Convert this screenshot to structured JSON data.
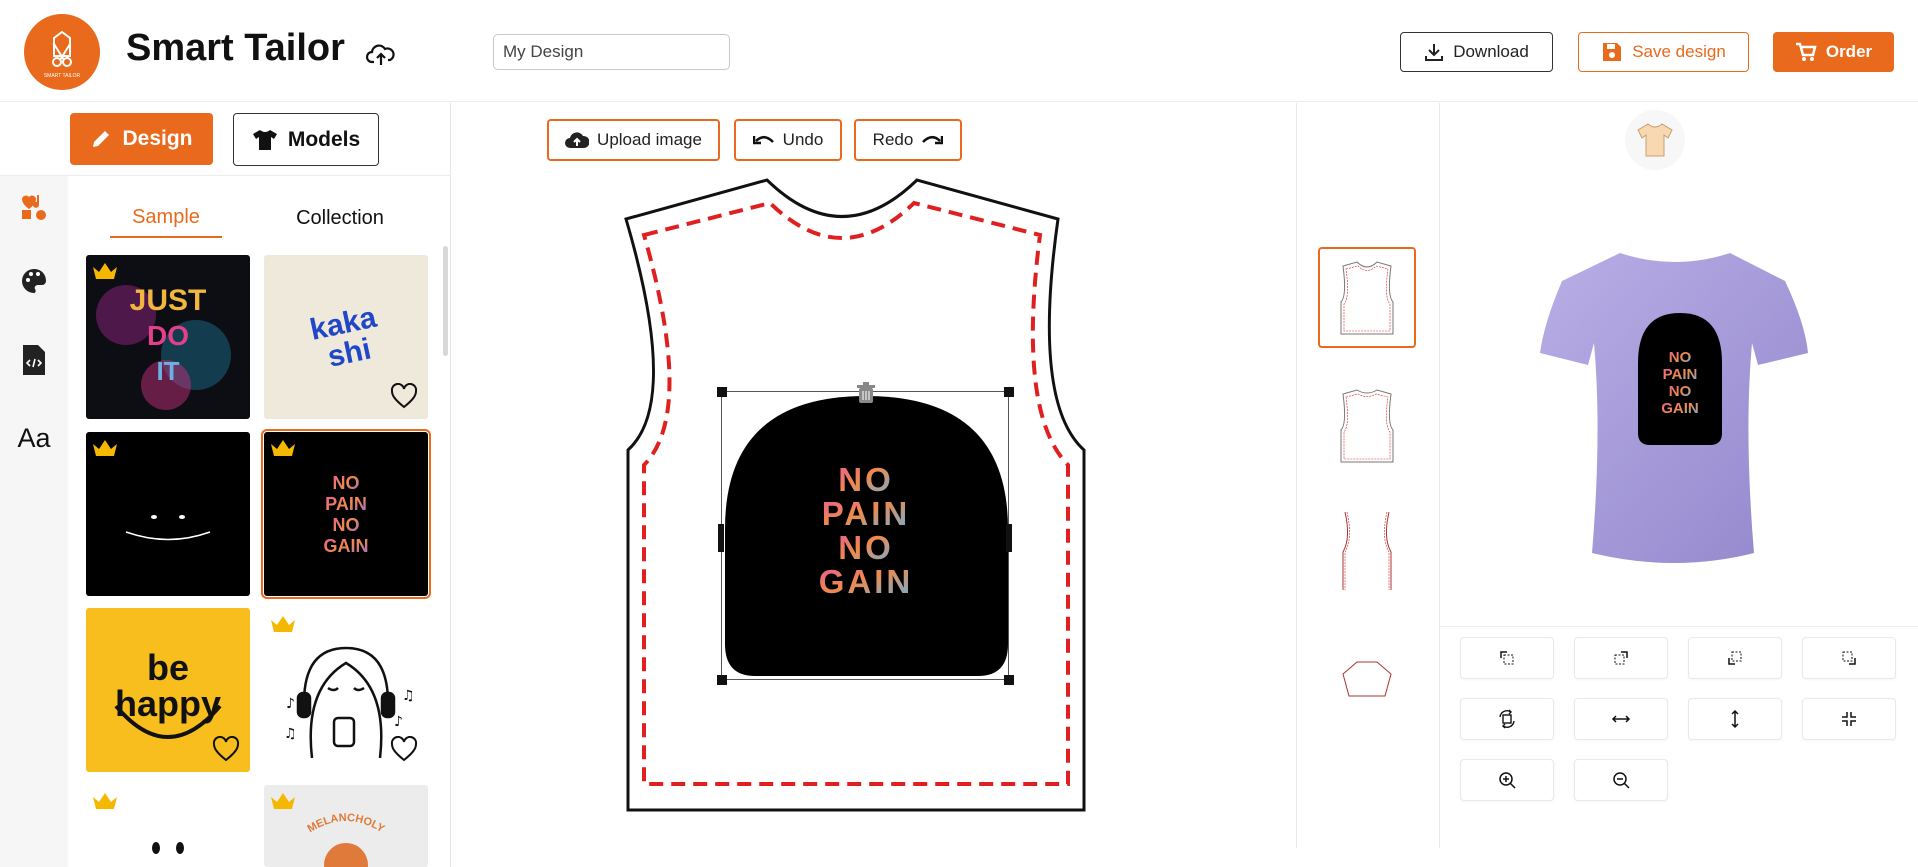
{
  "header": {
    "app_title": "Smart Tailor",
    "logo_text": "SMART TAILOR",
    "design_name_value": "My Design",
    "download_label": "Download",
    "save_label": "Save design",
    "order_label": "Order"
  },
  "left_panel": {
    "design_label": "Design",
    "models_label": "Models",
    "tabs": {
      "sample": "Sample",
      "collection": "Collection"
    },
    "rail_icons": [
      "stickers-icon",
      "palette-icon",
      "code-file-icon",
      "text-aa-icon"
    ],
    "rail_text": "Aa",
    "samples": [
      {
        "name": "just-do-it",
        "text": "JUST DO IT",
        "premium": true,
        "favorite": true
      },
      {
        "name": "kakashi",
        "text": "kakashi",
        "premium": false,
        "favorite": true
      },
      {
        "name": "smile",
        "text": "",
        "premium": true,
        "favorite": false
      },
      {
        "name": "no-pain-no-gain",
        "text": "NO PAIN NO GAIN",
        "premium": true,
        "favorite": false,
        "selected": true
      },
      {
        "name": "be-happy",
        "text": "be happy",
        "premium": false,
        "favorite": true
      },
      {
        "name": "music-doodle",
        "text": "",
        "premium": true,
        "favorite": true
      },
      {
        "name": "dots",
        "text": "",
        "premium": true,
        "favorite": false
      },
      {
        "name": "melancholy",
        "text": "MELANCHOLY",
        "premium": true,
        "favorite": false
      }
    ]
  },
  "toolbar": {
    "upload_label": "Upload image",
    "undo_label": "Undo",
    "redo_label": "Redo"
  },
  "canvas": {
    "design_text_lines": [
      "NO",
      "PAIN",
      "NO",
      "GAIN"
    ]
  },
  "part_thumbnails": [
    "front",
    "back",
    "sleeves",
    "collar"
  ],
  "controls": [
    "align-top-left-icon",
    "align-top-right-icon",
    "align-bottom-left-icon",
    "align-bottom-right-icon",
    "rotate-icon",
    "stretch-horizontal-icon",
    "stretch-vertical-icon",
    "shrink-icon",
    "zoom-in-icon",
    "zoom-out-icon"
  ],
  "colors": {
    "accent": "#e96a1c",
    "shirt_preview": "#a79bd8",
    "seam_line": "#e02020"
  }
}
